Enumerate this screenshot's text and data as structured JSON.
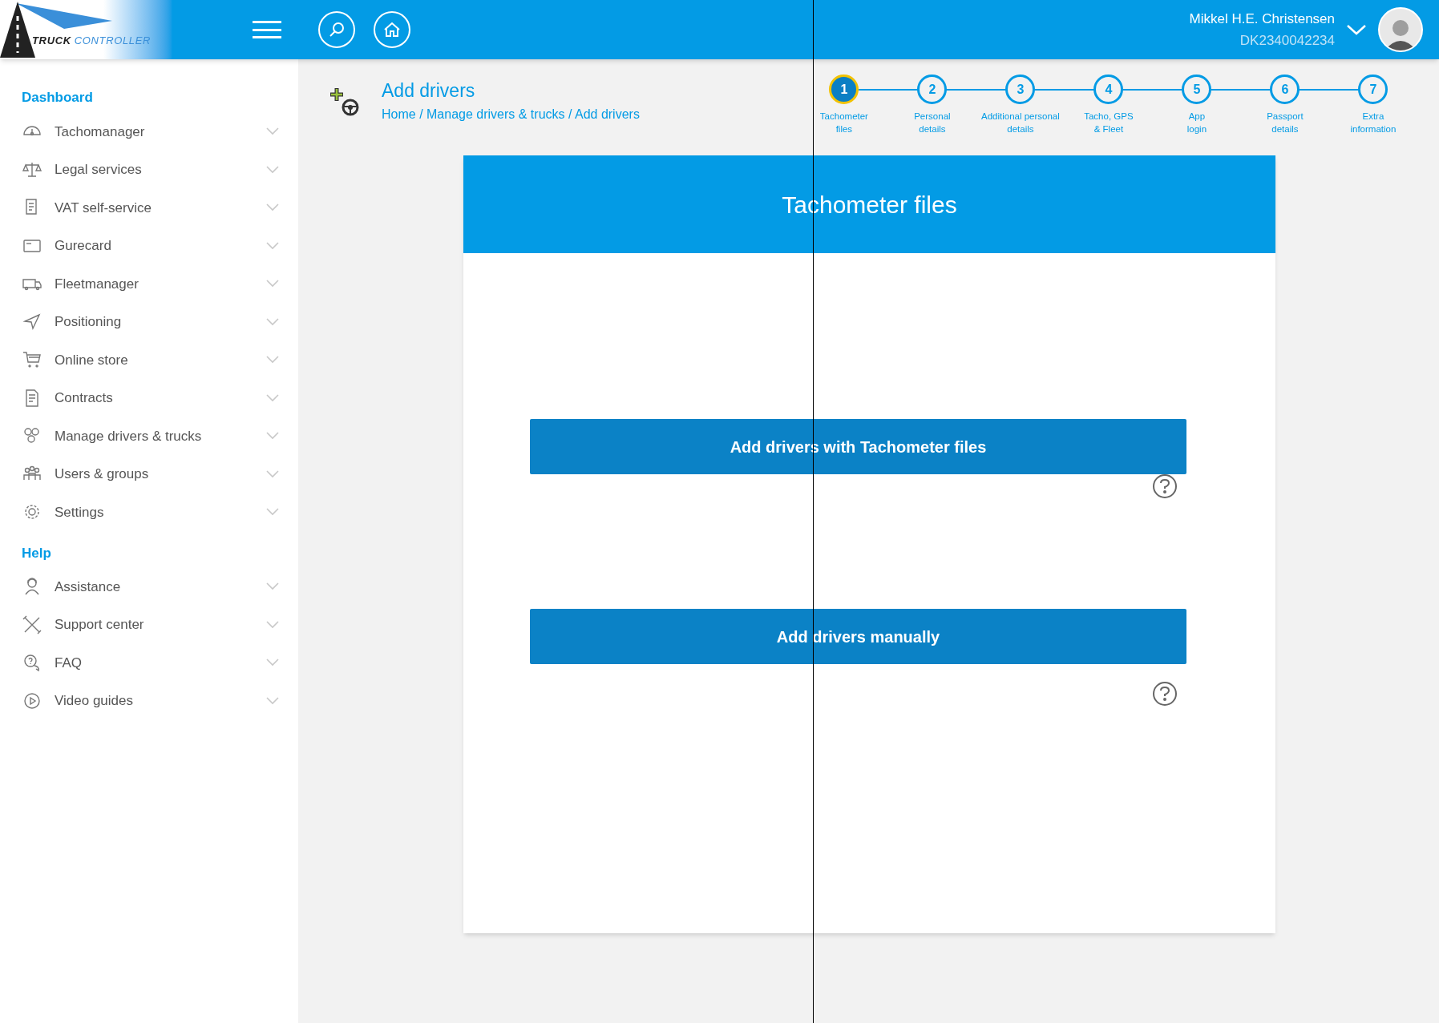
{
  "header": {
    "logo_text": [
      "TRUCK",
      "CONTROLLER"
    ],
    "user": {
      "name": "Mikkel H.E. Christensen",
      "account": "DK2340042234"
    }
  },
  "sidebar": {
    "sections": [
      {
        "title": "Dashboard",
        "items": [
          {
            "label": "Tachomanager"
          },
          {
            "label": "Legal services"
          },
          {
            "label": "VAT self-service"
          },
          {
            "label": "Gurecard"
          },
          {
            "label": "Fleetmanager"
          },
          {
            "label": "Positioning"
          },
          {
            "label": "Online store"
          },
          {
            "label": "Contracts"
          },
          {
            "label": "Manage drivers & trucks"
          },
          {
            "label": "Users & groups"
          },
          {
            "label": "Settings"
          }
        ]
      },
      {
        "title": "Help",
        "items": [
          {
            "label": "Assistance"
          },
          {
            "label": "Support center"
          },
          {
            "label": "FAQ"
          },
          {
            "label": "Video guides"
          }
        ]
      }
    ]
  },
  "page": {
    "title": "Add drivers",
    "breadcrumb": "Home / Manage drivers & trucks / Add drivers"
  },
  "steps": [
    {
      "number": "1",
      "label": "Tachometer\nfiles",
      "selected": true
    },
    {
      "number": "2",
      "label": "Personal\ndetails",
      "selected": false
    },
    {
      "number": "3",
      "label": "Additional personal\ndetails",
      "selected": false
    },
    {
      "number": "4",
      "label": "Tacho, GPS\n& Fleet",
      "selected": false
    },
    {
      "number": "5",
      "label": "App\nlogin",
      "selected": false
    },
    {
      "number": "6",
      "label": "Passport\ndetails",
      "selected": false
    },
    {
      "number": "7",
      "label": "Extra\ninformation",
      "selected": false
    }
  ],
  "card": {
    "title": "Tachometer files",
    "options": [
      {
        "label": "Add drivers with Tachometer files"
      },
      {
        "label": "Add drivers manually"
      }
    ]
  }
}
